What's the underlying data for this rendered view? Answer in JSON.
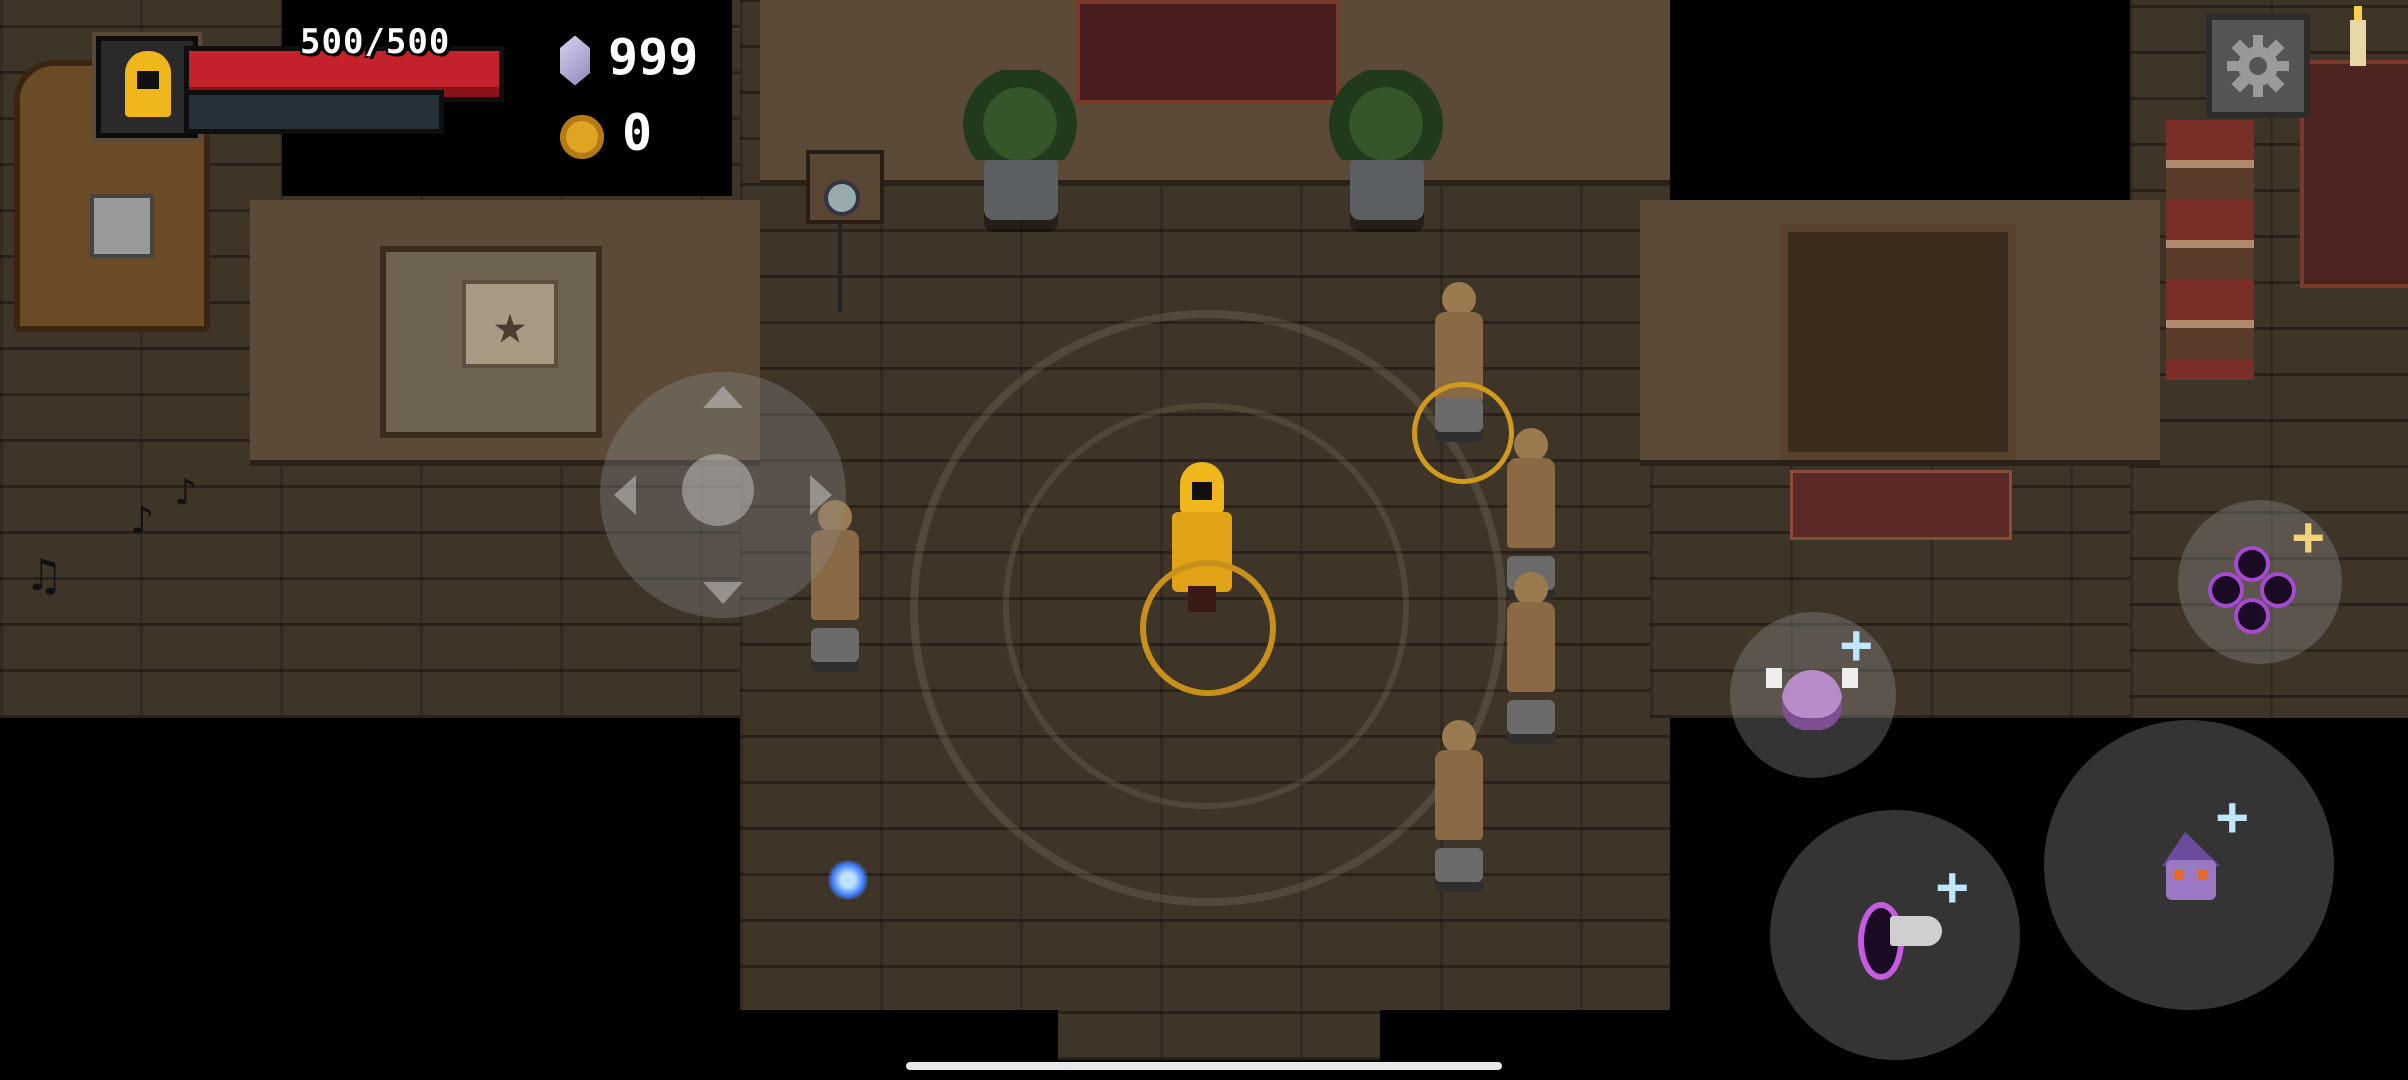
{
  "hud": {
    "health_text": "500/500",
    "health_fraction": 1.0,
    "gems": "999",
    "gold": "0",
    "colors": {
      "health": "#c3222b",
      "gem": "#b9b2df",
      "gold": "#e0a324"
    },
    "portrait_icon": "hooded-wizard-portrait-icon"
  },
  "controls": {
    "settings_icon": "gear-icon",
    "joystick_icon": "dpad-joystick-icon",
    "skills": [
      {
        "name": "dark-orbs-skill",
        "icon": "dark-orbs-icon"
      },
      {
        "name": "horned-spirit-skill",
        "icon": "horned-spirit-icon"
      },
      {
        "name": "portal-dash-skill",
        "icon": "portal-dash-icon"
      },
      {
        "name": "wizard-skull-skill",
        "icon": "wizard-skull-icon"
      }
    ],
    "plus_glyph": "+"
  },
  "scene": {
    "floor_color": "#3e3427",
    "wall_color": "#5a4a37",
    "music_glyph": "♫",
    "note_glyph": "♪"
  }
}
